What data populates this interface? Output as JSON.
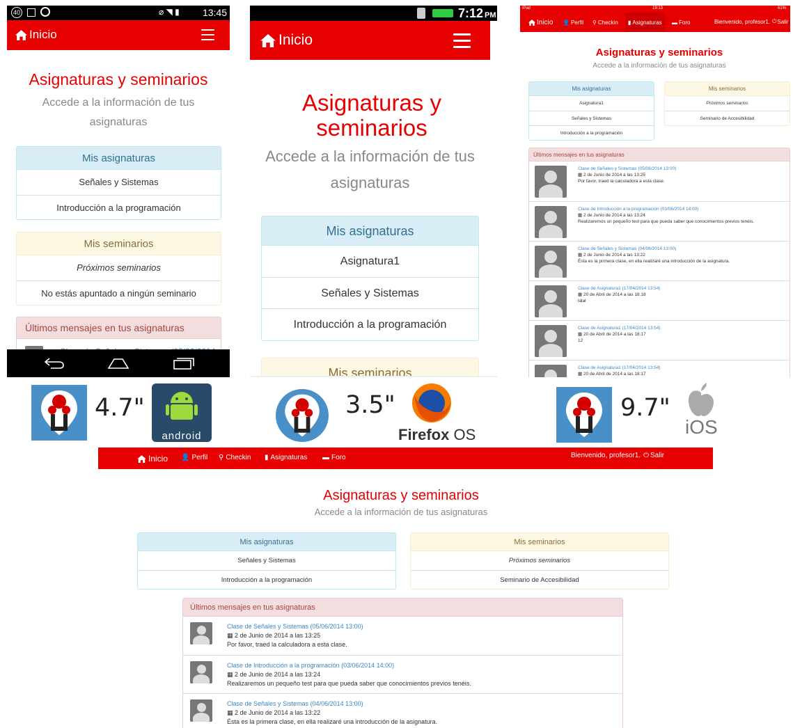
{
  "nav": {
    "inicio": "Inicio",
    "perfil": "Perfil",
    "checkin": "Checkin",
    "asignaturas": "Asignaturas",
    "foro": "Foro",
    "welcome": "Bienvenido, profesor1.",
    "salir": "Salir"
  },
  "page": {
    "title": "Asignaturas y seminarios",
    "subtitle": "Accede a la información de tus asignaturas",
    "subtitle_line1": "Accede a la información de tus",
    "subtitle_line2": "asignaturas"
  },
  "subjects_panel": {
    "title": "Mis asignaturas",
    "items": [
      "Señales y Sistemas",
      "Introducción a la programación"
    ],
    "items_alt": [
      "Asignatura1",
      "Señales y Sistemas",
      "Introducción a la programación"
    ]
  },
  "seminars_panel": {
    "title": "Mis seminarios",
    "upcoming": "Próximos seminarios",
    "none": "No estás apuntado a ningún seminario",
    "accessibility": "Seminario de Accesibilidad"
  },
  "messages_panel": {
    "title": "Últimos mensajes en tus asignaturas",
    "peek": "Clase de Señales y Sistemas (05/06/2014",
    "items": [
      {
        "link": "Clase de Señales y Sistemas (05/06/2014 13:00)",
        "date": "2 de Junio de 2014 a las 13:25",
        "text": "Por favor, traed la calculadora a esta clase."
      },
      {
        "link": "Clase de Introducción a la programación (03/06/2014 14:00)",
        "date": "2 de Junio de 2014 a las 13:24",
        "text": "Realizaremos un pequeño test para que pueda saber que conocimientos previos tenéis."
      },
      {
        "link": "Clase de Señales y Sistemas (04/06/2014 13:00)",
        "date": "2 de Junio de 2014 a las 13:22",
        "text": "Ésta es la primera clase, en ella realizaré una introducción de la asignatura."
      },
      {
        "link": "Clase de Asignatura1 (17/04/2014 13:54)",
        "date": "20 de Abril de 2014 a las 18:18",
        "text": "lalal"
      },
      {
        "link": "Clase de Asignatura1 (17/04/2014 13:54)",
        "date": "20 de Abril de 2014 a las 18:17",
        "text": "12"
      },
      {
        "link": "Clase de Asignatura1 (17/04/2014 13:54)",
        "date": "20 de Abril de 2014 a las 18:17",
        "text": ""
      }
    ]
  },
  "devices": {
    "android": {
      "status_left": "40",
      "time": "13:45",
      "size": "4.7\"",
      "os_label": "android"
    },
    "firefox": {
      "time": "7:12",
      "ampm": "PM",
      "size": "3.5\"",
      "os_label_1": "Firefox",
      "os_label_2": "OS"
    },
    "ios": {
      "carrier": "iPad",
      "time": "19:13",
      "battery": "61%",
      "size": "9.7\"",
      "os_label": "iOS"
    }
  },
  "colors": {
    "brand_red": "#e60000",
    "info_bg": "#d9edf7",
    "warning_bg": "#fcf8e3",
    "danger_bg": "#f2dede",
    "link": "#3a87c8"
  },
  "icons": [
    "home-icon",
    "hamburger-icon",
    "user-icon",
    "map-marker-icon",
    "book-icon",
    "comment-icon",
    "power-icon",
    "calendar-icon",
    "avatar-icon",
    "back-icon",
    "home-button-icon",
    "recent-apps-icon",
    "android-logo-icon",
    "firefox-logo-icon",
    "apple-logo-icon",
    "university-badge-icon"
  ]
}
